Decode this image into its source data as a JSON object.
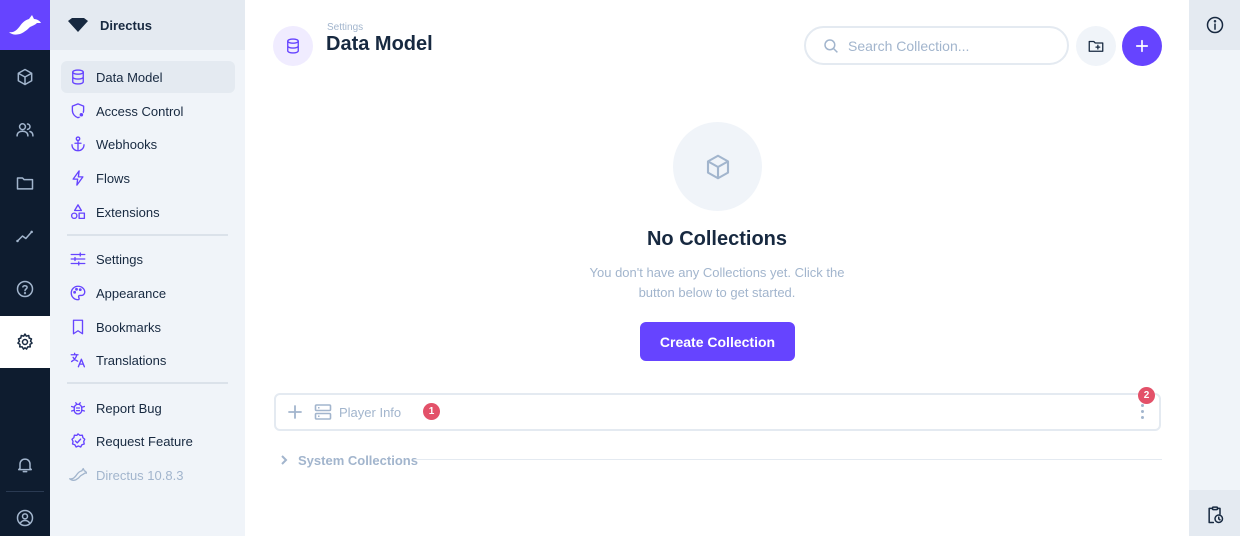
{
  "project": {
    "name": "Directus"
  },
  "modules": [
    {
      "icon": "box-icon",
      "name": "content"
    },
    {
      "icon": "users-icon",
      "name": "user-directory"
    },
    {
      "icon": "folder-icon",
      "name": "files"
    },
    {
      "icon": "insights-icon",
      "name": "insights"
    },
    {
      "icon": "help-icon",
      "name": "help"
    },
    {
      "icon": "gear-icon",
      "name": "settings",
      "active": true
    }
  ],
  "nav": {
    "data_model": "Data Model",
    "access_control": "Access Control",
    "webhooks": "Webhooks",
    "flows": "Flows",
    "extensions": "Extensions",
    "settings": "Settings",
    "appearance": "Appearance",
    "bookmarks": "Bookmarks",
    "translations": "Translations",
    "report_bug": "Report Bug",
    "request_feature": "Request Feature",
    "version": "Directus 10.8.3"
  },
  "header": {
    "breadcrumb": "Settings",
    "title": "Data Model",
    "search_placeholder": "Search Collection..."
  },
  "empty": {
    "title": "No Collections",
    "text": "You don't have any Collections yet. Click the button below to get started.",
    "button": "Create Collection"
  },
  "collection": {
    "name": "Player Info",
    "badge": "1"
  },
  "menu_badge": "2",
  "system_collections": "System Collections",
  "colors": {
    "accent": "#6644ff",
    "module_bar": "#0e1c2f",
    "danger": "#e35169"
  }
}
